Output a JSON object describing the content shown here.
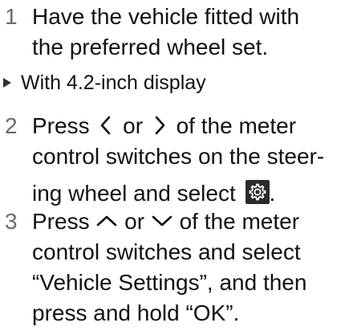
{
  "steps": [
    {
      "number": "1",
      "lines": [
        "Have the vehicle fitted with",
        "the preferred wheel set."
      ]
    },
    {
      "number": "2",
      "line1_prefix": "Press",
      "line1_or": "or",
      "line1_suffix": "of the meter",
      "line2": "control switches on the steer-",
      "line3_prefix": "ing wheel and select",
      "line3_suffix": ".",
      "icons": [
        "left-angle-icon",
        "right-angle-icon",
        "settings-gear-icon"
      ]
    },
    {
      "number": "3",
      "line1_prefix": "Press",
      "line1_or": "or",
      "line1_suffix": "of the meter",
      "lines": [
        "control switches and select",
        "“Vehicle Settings”, and then",
        "press and hold “OK”."
      ],
      "icons": [
        "up-chevron-icon",
        "down-chevron-icon"
      ]
    }
  ],
  "condition": {
    "text": "With 4.2-inch display"
  },
  "colors": {
    "text": "#111111",
    "step_number": "#6a6a6a",
    "icon_box": "#2b2b2b",
    "icon_fg": "#ffffff"
  }
}
